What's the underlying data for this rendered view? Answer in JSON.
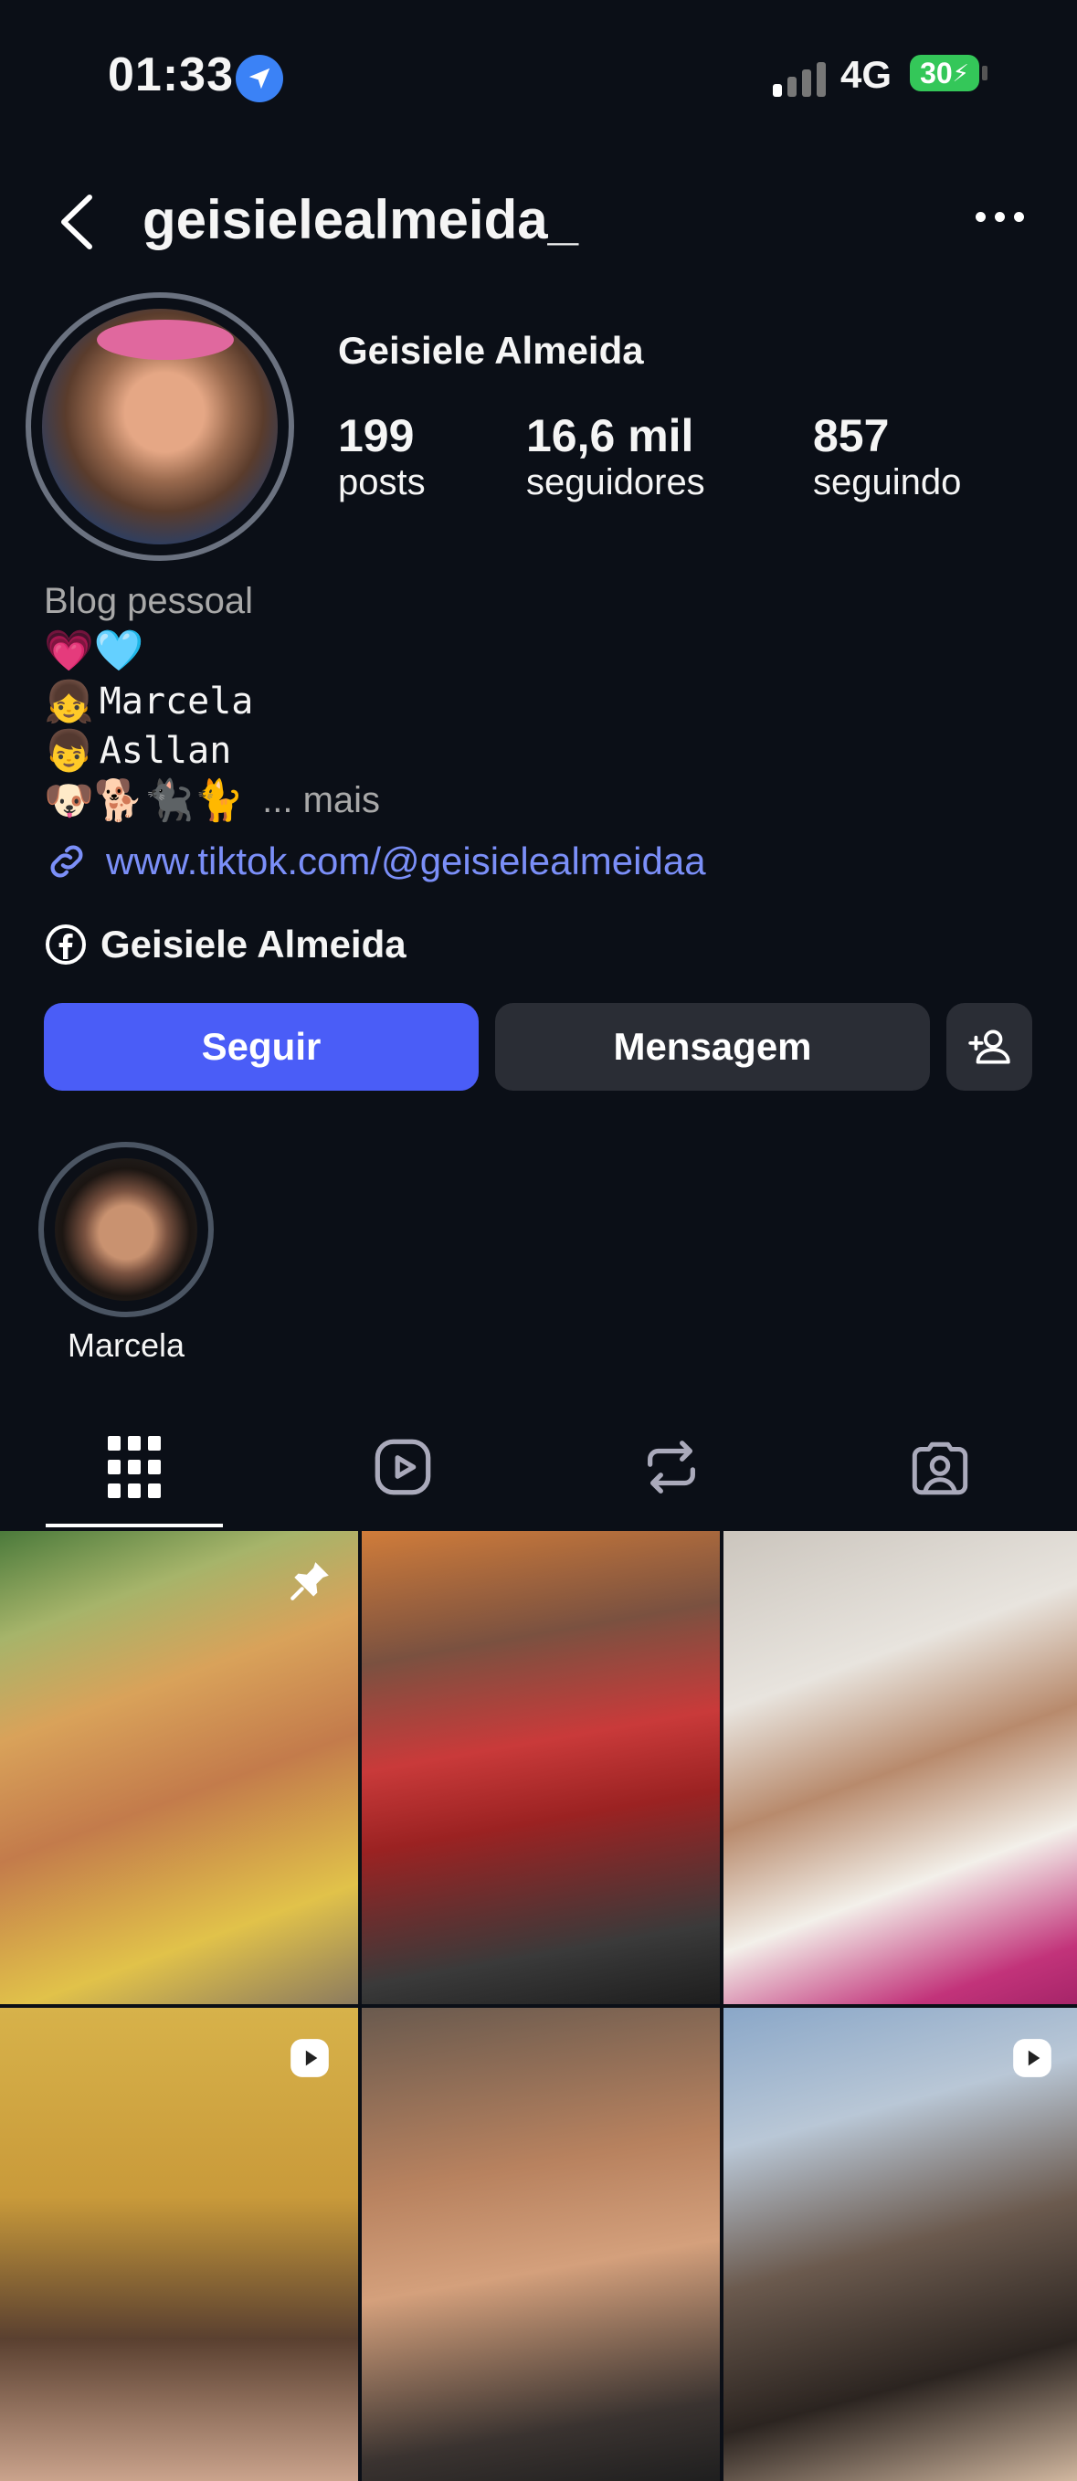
{
  "status_bar": {
    "time": "01:33",
    "network": "4G",
    "battery": "30"
  },
  "header": {
    "username": "geisielealmeida_"
  },
  "profile": {
    "full_name": "Geisiele Almeida",
    "stats": [
      {
        "value": "199",
        "label": "posts"
      },
      {
        "value": "16,6 mil",
        "label": "seguidores"
      },
      {
        "value": "857",
        "label": "seguindo"
      }
    ],
    "category": "Blog pessoal",
    "bio": {
      "line1_emoji": "💗🩵",
      "line2_emoji": "👧",
      "line2_text": "Marcela",
      "line3_emoji": "👦",
      "line3_text": "Asllan",
      "line4_emoji": "🐶🐕🐈‍⬛🐈",
      "more": "... mais"
    },
    "link": "www.tiktok.com/@geisielealmeidaa",
    "facebook_name": "Geisiele Almeida"
  },
  "actions": {
    "follow": "Seguir",
    "message": "Mensagem"
  },
  "highlights": [
    {
      "label": "Marcela"
    }
  ]
}
